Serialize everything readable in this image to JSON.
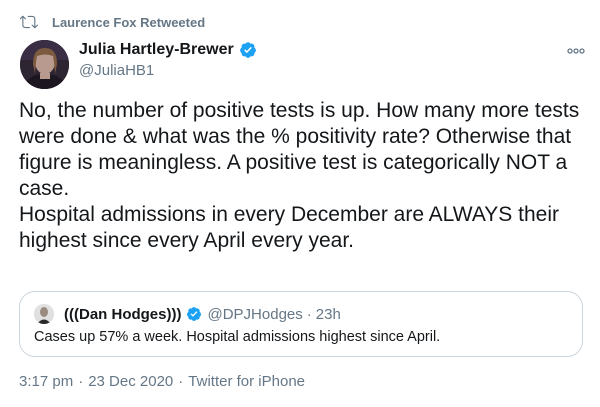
{
  "retweet": {
    "label": "Laurence Fox Retweeted"
  },
  "author": {
    "name": "Julia Hartley-Brewer",
    "handle": "@JuliaHB1"
  },
  "tweet": {
    "lines": [
      "No, the number of positive tests is up. How many more tests were done & what was the % positivity rate? Otherwise that figure is meaningless. A positive test is categorically NOT a case.",
      "Hospital admissions in every December are ALWAYS their highest since every April every year."
    ]
  },
  "quote": {
    "name": "(((Dan Hodges)))",
    "handle": "@DPJHodges",
    "separator": "·",
    "time": "23h",
    "text": "Cases up 57% a week. Hospital admissions highest since April."
  },
  "meta": {
    "time": "3:17 pm",
    "separator": "·",
    "date": "23 Dec 2020",
    "source": "Twitter for iPhone"
  },
  "colors": {
    "verified": "#1da1f2",
    "secondary_text": "#657786",
    "border": "#ccd6dd"
  }
}
